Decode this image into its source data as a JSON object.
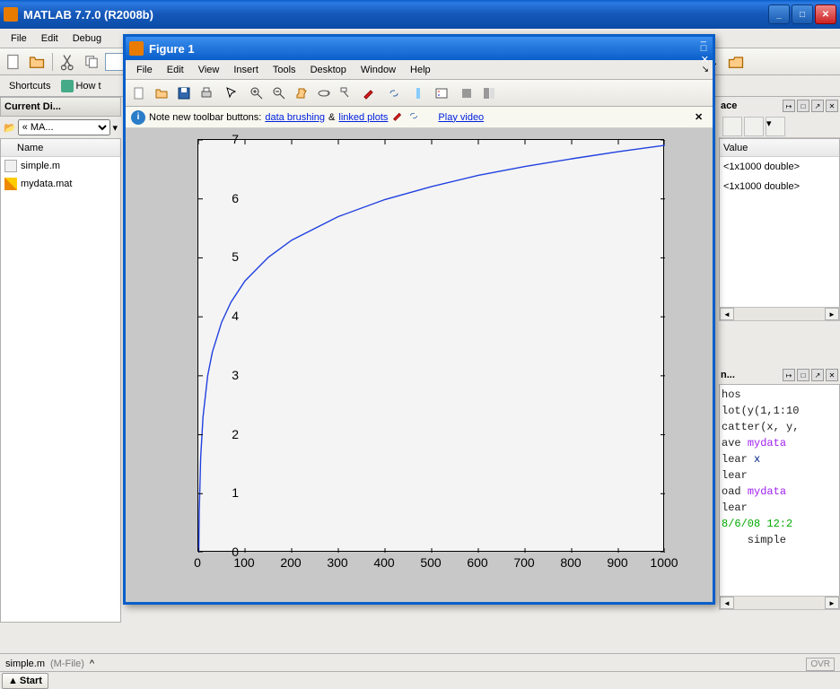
{
  "app": {
    "title": "MATLAB  7.7.0 (R2008b)",
    "menus": [
      "File",
      "Edit",
      "Debug"
    ]
  },
  "shortcuts": {
    "label": "Shortcuts",
    "howto": "How t"
  },
  "currentDir": {
    "title": "Current Di...",
    "combo": "« MA...",
    "nameCol": "Name",
    "files": [
      {
        "name": "simple.m",
        "kind": "m"
      },
      {
        "name": "mydata.mat",
        "kind": "mat"
      }
    ]
  },
  "workspace": {
    "title": "ace",
    "valueCol": "Value",
    "vars": [
      {
        "val": "<1x1000 double>"
      },
      {
        "val": "<1x1000 double>"
      }
    ]
  },
  "cmdHistory": {
    "title": "n...",
    "lines": [
      {
        "t": "hos"
      },
      {
        "t": "lot(y(1,1:10"
      },
      {
        "t": "catter(x, y,"
      },
      {
        "t": "ave ",
        "kw": "mydata"
      },
      {
        "t": "lear ",
        "var": "x"
      },
      {
        "t": "lear"
      },
      {
        "t": "oad ",
        "kw": "mydata"
      },
      {
        "t": "lear"
      },
      {
        "date": "8/6/08 12:2"
      },
      {
        "indent": true,
        "t": "simple"
      }
    ]
  },
  "statusbar": {
    "file": "simple.m",
    "type": "(M-File)",
    "ovr": "OVR"
  },
  "start": {
    "label": "Start"
  },
  "figure": {
    "title": "Figure 1",
    "menus": [
      "File",
      "Edit",
      "View",
      "Insert",
      "Tools",
      "Desktop",
      "Window",
      "Help"
    ],
    "info": {
      "prefix": "Note new toolbar buttons:",
      "link1": "data brushing",
      "amp": "&",
      "link2": "linked plots",
      "video": "Play video"
    }
  },
  "chart_data": {
    "type": "line",
    "title": "",
    "xlabel": "",
    "ylabel": "",
    "xlim": [
      0,
      1000
    ],
    "ylim": [
      0,
      7
    ],
    "xticks": [
      0,
      100,
      200,
      300,
      400,
      500,
      600,
      700,
      800,
      900,
      1000
    ],
    "yticks": [
      0,
      1,
      2,
      3,
      4,
      5,
      6,
      7
    ],
    "x": [
      1,
      2,
      5,
      10,
      20,
      30,
      50,
      70,
      100,
      150,
      200,
      300,
      400,
      500,
      600,
      700,
      800,
      900,
      1000
    ],
    "y": [
      0.0,
      0.69,
      1.61,
      2.3,
      3.0,
      3.4,
      3.91,
      4.25,
      4.61,
      5.01,
      5.3,
      5.7,
      5.99,
      6.21,
      6.4,
      6.55,
      6.68,
      6.8,
      6.91
    ]
  }
}
